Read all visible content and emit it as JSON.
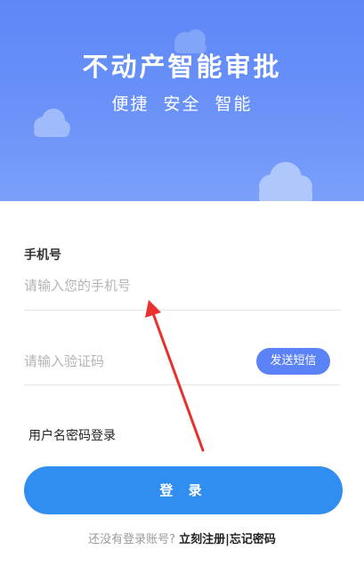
{
  "banner": {
    "title": "不动产智能审批",
    "subtitle": "便捷 安全 智能",
    "background_color": "#6a8ff8"
  },
  "form": {
    "phone_label": "手机号",
    "phone_placeholder": "请输入您的手机号",
    "code_placeholder": "请输入验证码",
    "sms_button_label": "发送短信",
    "switch_login_label": "用户名密码登录",
    "login_button_label": "登 录"
  },
  "footer": {
    "hint": "还没有登录账号?",
    "register_label": "立刻注册",
    "separator": "|",
    "forgot_label": "忘记密码"
  },
  "colors": {
    "accent": "#2f8eef",
    "sms_button": "#5b82f6",
    "annotation_arrow": "#e8312f"
  },
  "icons": [
    "cloud-icon",
    "arrow-annotation"
  ]
}
